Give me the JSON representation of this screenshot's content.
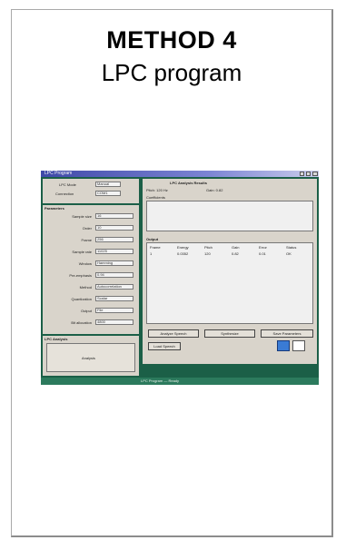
{
  "slide": {
    "title": "METHOD 4",
    "subtitle": "LPC program"
  },
  "screenshot": {
    "window_title": "LPC Program",
    "status_text": "LPC Program  —  Ready",
    "left_panel": {
      "top_fields": [
        {
          "label": "LPC Mode",
          "value": "Manual"
        },
        {
          "label": "Connection",
          "value": "COM1"
        }
      ],
      "section_title": "Parameters",
      "fields": [
        {
          "label": "Sample size",
          "value": "16"
        },
        {
          "label": "Order",
          "value": "10"
        },
        {
          "label": "Frame",
          "value": "256"
        },
        {
          "label": "Sample rate",
          "value": "11025"
        },
        {
          "label": "Window",
          "value": "Hamming"
        },
        {
          "label": "Pre-emphasis",
          "value": "0.94"
        },
        {
          "label": "Method",
          "value": "Autocorrelation"
        },
        {
          "label": "Quantization",
          "value": "Scalar"
        },
        {
          "label": "Output",
          "value": "File"
        },
        {
          "label": "Bit allocation",
          "value": "4800"
        }
      ],
      "bottom_section_title": "LPC Analysis",
      "bottom_box_text": "Analysis"
    },
    "right_panel": {
      "header": "LPC Analysis Results",
      "info_line_1": "Pitch: 120 Hz",
      "info_line_2": "Gain: 0.82",
      "coef_label": "Coefficients",
      "table_title": "Output",
      "table_columns": [
        "Frame",
        "Energy",
        "Pitch",
        "Gain",
        "Error",
        "Status"
      ],
      "table_row": [
        "1",
        "0.0352",
        "120",
        "0.82",
        "0.01",
        "OK"
      ],
      "buttons": [
        "Analyze Speech",
        "Synthesize",
        "Save Parameters",
        "Load Speech"
      ]
    },
    "colors": {
      "background": "#1b5f47",
      "panel": "#d9d4cb",
      "titlebar": "#3f49a8"
    }
  }
}
